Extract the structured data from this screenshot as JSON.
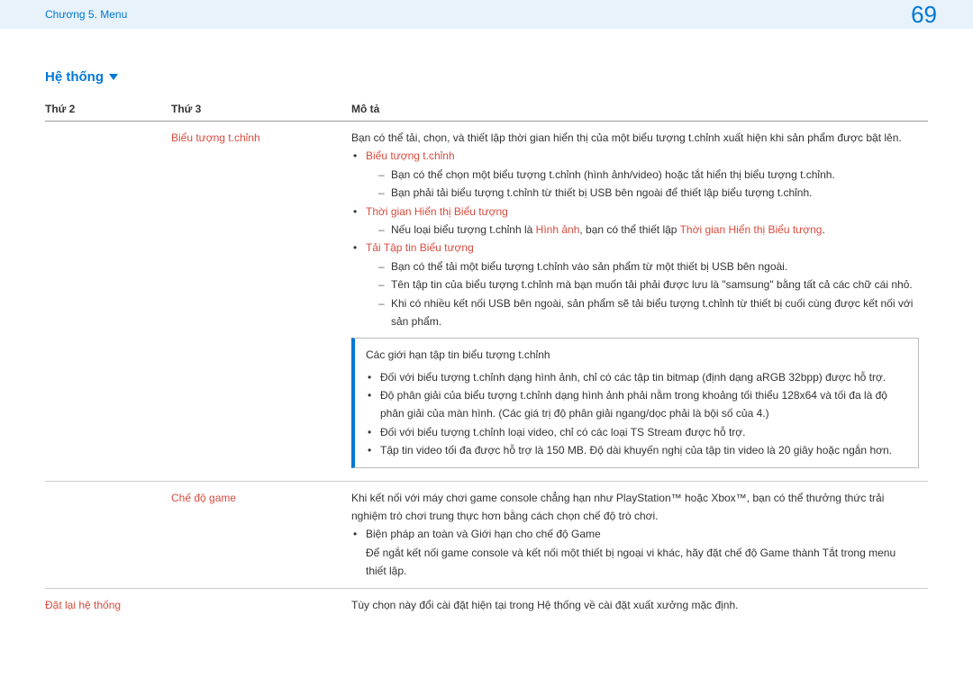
{
  "topbar": {
    "chapter": "Chương 5. Menu",
    "page": "69"
  },
  "section": {
    "title": "Hệ thống"
  },
  "headers": {
    "col1": "Thứ 2",
    "col2": "Thứ 3",
    "col3": "Mô tả"
  },
  "row1": {
    "thu3": "Biểu tượng t.chỉnh",
    "intro": "Bạn có thể tải, chọn, và thiết lập thời gian hiển thị của một biểu tượng t.chỉnh xuất hiện khi sản phẩm được bật lên.",
    "b1_title": "Biểu tượng t.chỉnh",
    "b1_s1": "Bạn có thể chọn một biểu tượng t.chỉnh (hình ảnh/video) hoặc tắt hiển thị biểu tượng t.chỉnh.",
    "b1_s2": "Bạn phải tải biểu tượng t.chỉnh từ thiết bị USB bên ngoài để thiết lập biểu tượng t.chỉnh.",
    "b2_title": "Thời gian Hiển thị Biểu tượng",
    "b2_s1a": "Nếu loại biểu tượng t.chỉnh là ",
    "b2_s1b": "Hình ảnh",
    "b2_s1c": ", bạn có thể thiết lập ",
    "b2_s1d": "Thời gian Hiển thị Biểu tượng",
    "b2_s1e": ".",
    "b3_title": "Tải Tập tin Biểu tượng",
    "b3_s1": "Bạn có thể tải một biểu tượng t.chỉnh vào sản phẩm từ một thiết bị USB bên ngoài.",
    "b3_s2": "Tên tập tin của biểu tượng t.chỉnh mà bạn muốn tải phải được lưu là \"samsung\" bằng tất cả các chữ cái nhỏ.",
    "b3_s3": "Khi có nhiều kết nối USB bên ngoài, sản phẩm sẽ tải biểu tượng t.chỉnh từ thiết bị cuối cùng được kết nối với sản phẩm.",
    "note_title": "Các giới hạn tập tin biểu tượng t.chỉnh",
    "note_li1": "Đối với biểu tượng t.chỉnh dạng hình ảnh, chỉ có các tập tin bitmap (định dạng aRGB 32bpp) được hỗ trợ.",
    "note_li2": "Độ phân giải của biểu tượng t.chỉnh dạng hình ảnh phải nằm trong khoảng tối thiểu 128x64 và tối đa là độ phân giải của màn hình. (Các giá trị độ phân giải ngang/dọc phải là bội số của 4.)",
    "note_li3": "Đối với biểu tượng t.chỉnh loại video, chỉ có các loại TS Stream được hỗ trợ.",
    "note_li4": "Tập tin video tối đa được hỗ trợ là 150 MB. Độ dài khuyến nghị của tập tin video là 20 giây hoặc ngắn hơn."
  },
  "row2": {
    "thu3": "Chế độ game",
    "p1": "Khi kết nối với máy chơi game console chẳng hạn như PlayStation™ hoặc Xbox™, bạn có thể thưởng thức trải nghiệm trò chơi trung thực hơn bằng cách chọn chế độ trò chơi.",
    "li1": "Biện pháp an toàn và Giới hạn cho chế độ Game",
    "p2": "Để ngắt kết nối game console và kết nối một thiết bị ngoại vi khác, hãy đặt chế độ Game thành Tắt trong menu thiết lập."
  },
  "row3": {
    "thu2": "Đặt lại hệ thống",
    "desc": "Tùy chọn này đổi cài đặt hiện tại trong Hệ thống về cài đặt xuất xưởng mặc định."
  }
}
